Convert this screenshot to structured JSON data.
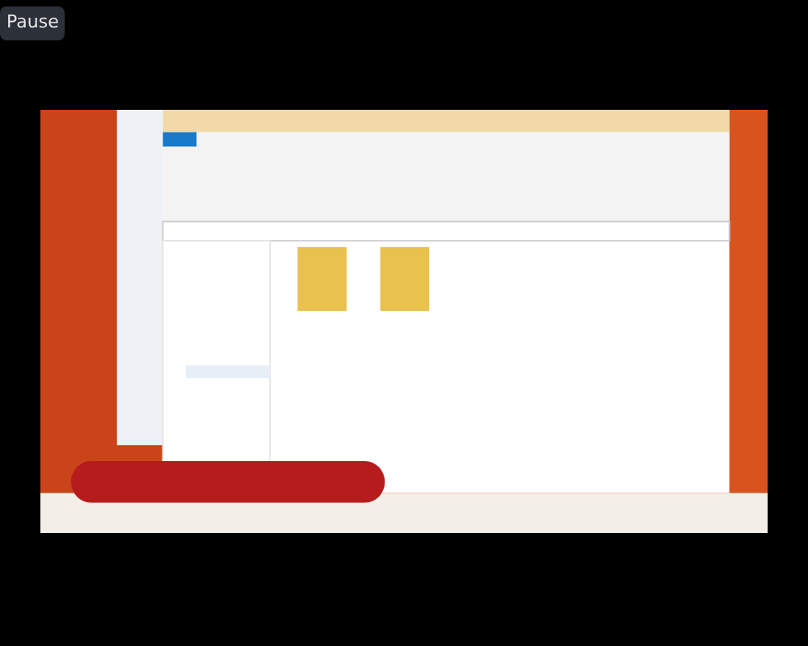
{
  "player": {
    "pause_button": "Pause"
  }
}
